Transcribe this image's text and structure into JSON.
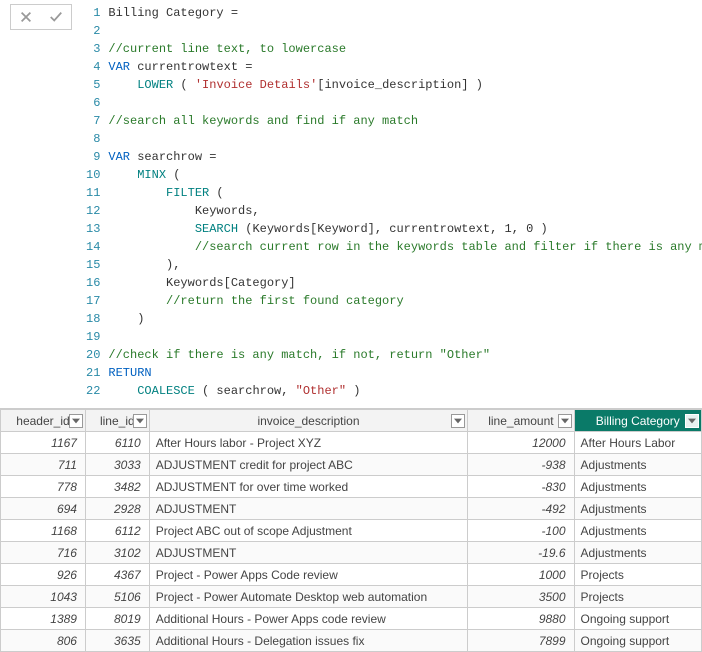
{
  "actions": {
    "cancel": "cancel",
    "commit": "commit"
  },
  "formula": {
    "lines": [
      [
        [
          "id",
          "Billing Category ="
        ]
      ],
      [],
      [
        [
          "com",
          "//current line text, to lowercase"
        ]
      ],
      [
        [
          "kw",
          "VAR"
        ],
        [
          "id",
          " currentrowtext ="
        ]
      ],
      [
        [
          "id",
          "    "
        ],
        [
          "func",
          "LOWER"
        ],
        [
          "id",
          " ( "
        ],
        [
          "str",
          "'Invoice Details'"
        ],
        [
          "id",
          "[invoice_description] )"
        ]
      ],
      [],
      [
        [
          "com",
          "//search all keywords and find if any match"
        ]
      ],
      [],
      [
        [
          "kw",
          "VAR"
        ],
        [
          "id",
          " searchrow ="
        ]
      ],
      [
        [
          "id",
          "    "
        ],
        [
          "func",
          "MINX"
        ],
        [
          "id",
          " ("
        ]
      ],
      [
        [
          "id",
          "        "
        ],
        [
          "func",
          "FILTER"
        ],
        [
          "id",
          " ("
        ]
      ],
      [
        [
          "id",
          "            Keywords,"
        ]
      ],
      [
        [
          "id",
          "            "
        ],
        [
          "func",
          "SEARCH"
        ],
        [
          "id",
          " (Keywords[Keyword], currentrowtext, "
        ],
        [
          "num",
          "1"
        ],
        [
          "id",
          ", "
        ],
        [
          "num",
          "0"
        ],
        [
          "id",
          " )"
        ]
      ],
      [
        [
          "id",
          "            "
        ],
        [
          "com",
          "//search current row in the keywords table and filter if there is any match"
        ]
      ],
      [
        [
          "id",
          "        ),"
        ]
      ],
      [
        [
          "id",
          "        Keywords[Category]"
        ]
      ],
      [
        [
          "id",
          "        "
        ],
        [
          "com",
          "//return the first found category"
        ]
      ],
      [
        [
          "id",
          "    )"
        ]
      ],
      [],
      [
        [
          "com",
          "//check if there is any match, if not, return \"Other\""
        ]
      ],
      [
        [
          "kw",
          "RETURN"
        ]
      ],
      [
        [
          "id",
          "    "
        ],
        [
          "func",
          "COALESCE"
        ],
        [
          "id",
          " ( searchrow, "
        ],
        [
          "str",
          "\"Other\""
        ],
        [
          "id",
          " )"
        ]
      ]
    ]
  },
  "table": {
    "columns": [
      {
        "key": "header_id",
        "label": "header_id",
        "type": "num",
        "cls": "col-hid"
      },
      {
        "key": "line_id",
        "label": "line_id",
        "type": "num",
        "cls": "col-lid"
      },
      {
        "key": "invoice_description",
        "label": "invoice_description",
        "type": "txt",
        "cls": "col-desc"
      },
      {
        "key": "line_amount",
        "label": "line_amount",
        "type": "num",
        "cls": "col-amt"
      },
      {
        "key": "billing_category",
        "label": "Billing Category",
        "type": "txt",
        "cls": "col-cat",
        "highlight": true
      }
    ],
    "rows": [
      {
        "header_id": "1167",
        "line_id": "6110",
        "invoice_description": "After Hours labor - Project XYZ",
        "line_amount": "12000",
        "billing_category": "After Hours Labor"
      },
      {
        "header_id": "711",
        "line_id": "3033",
        "invoice_description": "ADJUSTMENT credit for project ABC",
        "line_amount": "-938",
        "billing_category": "Adjustments"
      },
      {
        "header_id": "778",
        "line_id": "3482",
        "invoice_description": "ADJUSTMENT for over time worked",
        "line_amount": "-830",
        "billing_category": "Adjustments"
      },
      {
        "header_id": "694",
        "line_id": "2928",
        "invoice_description": "ADJUSTMENT",
        "line_amount": "-492",
        "billing_category": "Adjustments"
      },
      {
        "header_id": "1168",
        "line_id": "6112",
        "invoice_description": "Project ABC out of scope Adjustment",
        "line_amount": "-100",
        "billing_category": "Adjustments"
      },
      {
        "header_id": "716",
        "line_id": "3102",
        "invoice_description": "ADJUSTMENT",
        "line_amount": "-19.6",
        "billing_category": "Adjustments"
      },
      {
        "header_id": "926",
        "line_id": "4367",
        "invoice_description": "Project - Power Apps Code review",
        "line_amount": "1000",
        "billing_category": "Projects"
      },
      {
        "header_id": "1043",
        "line_id": "5106",
        "invoice_description": "Project - Power Automate Desktop web automation",
        "line_amount": "3500",
        "billing_category": "Projects"
      },
      {
        "header_id": "1389",
        "line_id": "8019",
        "invoice_description": "Additional Hours - Power Apps code review",
        "line_amount": "9880",
        "billing_category": "Ongoing support"
      },
      {
        "header_id": "806",
        "line_id": "3635",
        "invoice_description": "Additional Hours - Delegation issues fix",
        "line_amount": "7899",
        "billing_category": "Ongoing support"
      }
    ]
  }
}
